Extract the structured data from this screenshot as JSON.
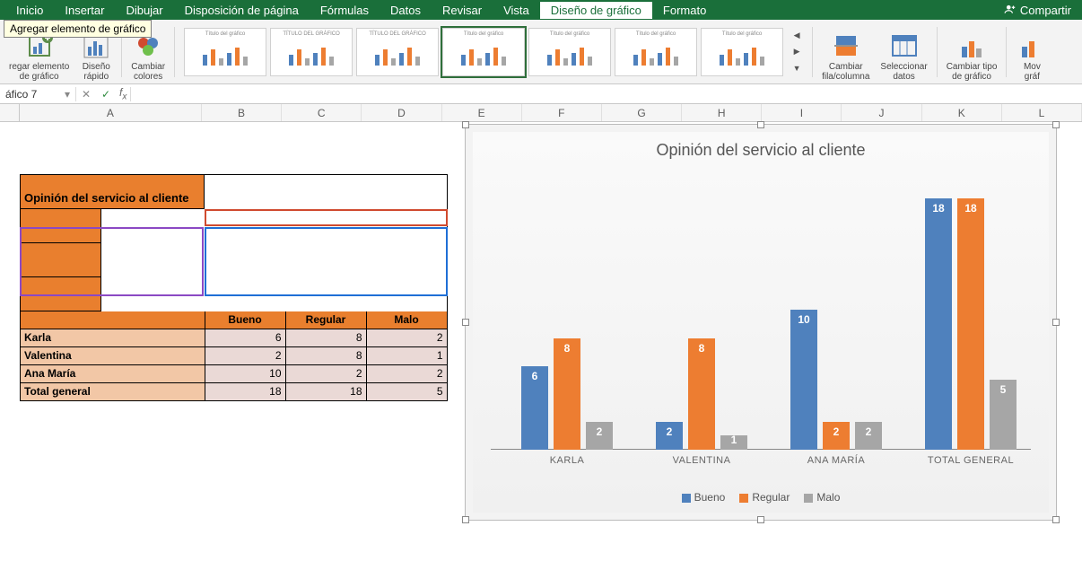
{
  "menu": {
    "items": [
      "Inicio",
      "Insertar",
      "Dibujar",
      "Disposición de página",
      "Fórmulas",
      "Datos",
      "Revisar",
      "Vista",
      "Diseño de gráfico",
      "Formato"
    ],
    "active": "Diseño de gráfico",
    "share": "Compartir"
  },
  "tooltip": "Agregar elemento de gráfico",
  "ribbon": {
    "groups": {
      "add_element": {
        "label1": "regar elemento",
        "label2": "de gráfico"
      },
      "quick_layout": {
        "label1": "Diseño",
        "label2": "rápido"
      },
      "change_colors": {
        "label1": "Cambiar",
        "label2": "colores"
      },
      "thumb_title": "Título del gráfico",
      "thumb_title_caps": "TÍTULO DEL GRÁFICO",
      "change_rowcol": {
        "label1": "Cambiar",
        "label2": "fila/columna"
      },
      "select_data": {
        "label1": "Seleccionar",
        "label2": "datos"
      },
      "change_type": {
        "label1": "Cambiar tipo",
        "label2": "de gráfico"
      },
      "move": {
        "label1": "Mov",
        "label2": "gráf"
      }
    }
  },
  "name_box": "áfico 7",
  "columns": [
    "A",
    "B",
    "C",
    "D",
    "E",
    "F",
    "G",
    "H",
    "I",
    "J",
    "K",
    "L"
  ],
  "table": {
    "title_header": "Opinión del servicio al cliente",
    "col_headers": [
      "Bueno",
      "Regular",
      "Malo"
    ],
    "rows": [
      {
        "name": "Karla",
        "vals": [
          6,
          8,
          2
        ]
      },
      {
        "name": "Valentina",
        "vals": [
          2,
          8,
          1
        ]
      },
      {
        "name": "Ana María",
        "vals": [
          10,
          2,
          2
        ]
      },
      {
        "name": "Total general",
        "vals": [
          18,
          18,
          5
        ]
      }
    ]
  },
  "chart_data": {
    "type": "bar",
    "title": "Opinión del servicio al cliente",
    "categories": [
      "KARLA",
      "VALENTINA",
      "ANA MARÍA",
      "TOTAL GENERAL"
    ],
    "series": [
      {
        "name": "Bueno",
        "color": "#4f81bd",
        "values": [
          6,
          2,
          10,
          18
        ]
      },
      {
        "name": "Regular",
        "color": "#ed7d31",
        "values": [
          8,
          8,
          2,
          18
        ]
      },
      {
        "name": "Malo",
        "color": "#a6a6a6",
        "values": [
          2,
          1,
          2,
          5
        ]
      }
    ],
    "ylim": [
      0,
      18
    ]
  }
}
